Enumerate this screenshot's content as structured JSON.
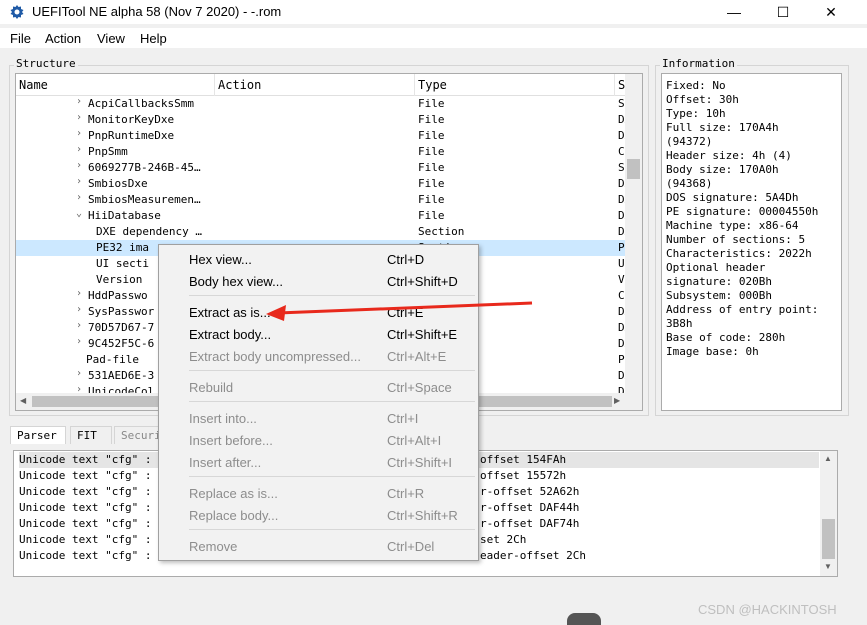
{
  "window": {
    "title": "UEFITool NE alpha 58 (Nov  7 2020) - -.rom",
    "minimize": "—",
    "maximize": "☐",
    "close": "✕"
  },
  "menu": [
    "File",
    "Action",
    "View",
    "Help"
  ],
  "structure": {
    "title": "Structure",
    "columns": [
      "Name",
      "Action",
      "Type",
      "S"
    ],
    "rows": [
      {
        "name": "AcpiCallbacksSmm",
        "type": "File",
        "s": "SM",
        "arrow": "›"
      },
      {
        "name": "MonitorKeyDxe",
        "type": "File",
        "s": "DX",
        "arrow": "›"
      },
      {
        "name": "PnpRuntimeDxe",
        "type": "File",
        "s": "DX",
        "arrow": "›"
      },
      {
        "name": "PnpSmm",
        "type": "File",
        "s": "Co",
        "arrow": "›"
      },
      {
        "name": "6069277B-246B-45…",
        "type": "File",
        "s": "SM",
        "arrow": "›"
      },
      {
        "name": "SmbiosDxe",
        "type": "File",
        "s": "DX",
        "arrow": "›"
      },
      {
        "name": "SmbiosMeasuremen…",
        "type": "File",
        "s": "DX",
        "arrow": "›"
      },
      {
        "name": "HiiDatabase",
        "type": "File",
        "s": "DX",
        "arrow": "⌄"
      },
      {
        "name": "DXE dependency …",
        "type": "Section",
        "s": "DX",
        "arrow": ""
      },
      {
        "name": "PE32 ima",
        "type": "Sectio",
        "s": "PE",
        "arrow": ""
      },
      {
        "name": "UI secti",
        "type": "",
        "s": "UI",
        "arrow": ""
      },
      {
        "name": "Version",
        "type": "",
        "s": "Ve",
        "arrow": ""
      },
      {
        "name": "HddPasswo",
        "type": "",
        "s": "Co",
        "arrow": "›"
      },
      {
        "name": "SysPasswor",
        "type": "",
        "s": "DX",
        "arrow": "›"
      },
      {
        "name": "70D57D67-7",
        "type": "",
        "s": "DX",
        "arrow": "›"
      },
      {
        "name": "9C452F5C-6",
        "type": "",
        "s": "DX",
        "arrow": "›"
      },
      {
        "name": "Pad-file",
        "type": "",
        "s": "Pa",
        "arrow": ""
      },
      {
        "name": "531AED6E-3",
        "type": "",
        "s": "DX",
        "arrow": "›"
      },
      {
        "name": "UnicodeCol",
        "type": "",
        "s": "DX",
        "arrow": "›"
      }
    ]
  },
  "information": {
    "title": "Information",
    "lines": [
      "Fixed: No",
      "Offset: 30h",
      "Type: 10h",
      "Full size: 170A4h",
      "(94372)",
      "Header size: 4h (4)",
      "Body size: 170A0h",
      "(94368)",
      "DOS signature: 5A4Dh",
      "PE signature: 00004550h",
      "Machine type: x86-64",
      "Number of sections: 5",
      "Characteristics: 2022h",
      "Optional header",
      "signature: 020Bh",
      "Subsystem: 000Bh",
      "Address of entry point:",
      "3B8h",
      "Base of code: 280h",
      "Image base: 0h"
    ]
  },
  "tabs": [
    "Parser",
    "FIT",
    "Securi"
  ],
  "log": {
    "lines": [
      {
        "left": "Unicode text \"cfg\" :",
        "right": "offset 154FAh"
      },
      {
        "left": "Unicode text \"cfg\" :",
        "right": "offset 15572h"
      },
      {
        "left": "Unicode text \"cfg\" :",
        "right": "r-offset 52A62h"
      },
      {
        "left": "Unicode text \"cfg\" :",
        "right": "r-offset DAF44h"
      },
      {
        "left": "Unicode text \"cfg\" :",
        "right": "r-offset DAF74h"
      },
      {
        "left": "Unicode text \"cfg\" :",
        "right": "set 2Ch"
      },
      {
        "left": "Unicode text \"cfg\" :",
        "right": "eader-offset 2Ch"
      }
    ]
  },
  "context_menu": {
    "items": [
      {
        "label": "Hex view...",
        "shortcut": "Ctrl+D",
        "enabled": true
      },
      {
        "label": "Body hex view...",
        "shortcut": "Ctrl+Shift+D",
        "enabled": true
      },
      {
        "label": "Extract as is...",
        "shortcut": "Ctrl+E",
        "enabled": true
      },
      {
        "label": "Extract body...",
        "shortcut": "Ctrl+Shift+E",
        "enabled": true
      },
      {
        "label": "Extract body uncompressed...",
        "shortcut": "Ctrl+Alt+E",
        "enabled": false
      },
      {
        "label": "Rebuild",
        "shortcut": "Ctrl+Space",
        "enabled": false
      },
      {
        "label": "Insert into...",
        "shortcut": "Ctrl+I",
        "enabled": false
      },
      {
        "label": "Insert before...",
        "shortcut": "Ctrl+Alt+I",
        "enabled": false
      },
      {
        "label": "Insert after...",
        "shortcut": "Ctrl+Shift+I",
        "enabled": false
      },
      {
        "label": "Replace as is...",
        "shortcut": "Ctrl+R",
        "enabled": false
      },
      {
        "label": "Replace body...",
        "shortcut": "Ctrl+Shift+R",
        "enabled": false
      },
      {
        "label": "Remove",
        "shortcut": "Ctrl+Del",
        "enabled": false
      }
    ]
  },
  "annotation_color": "#e8291c",
  "watermark": "CSDN @HACKINTOSH"
}
